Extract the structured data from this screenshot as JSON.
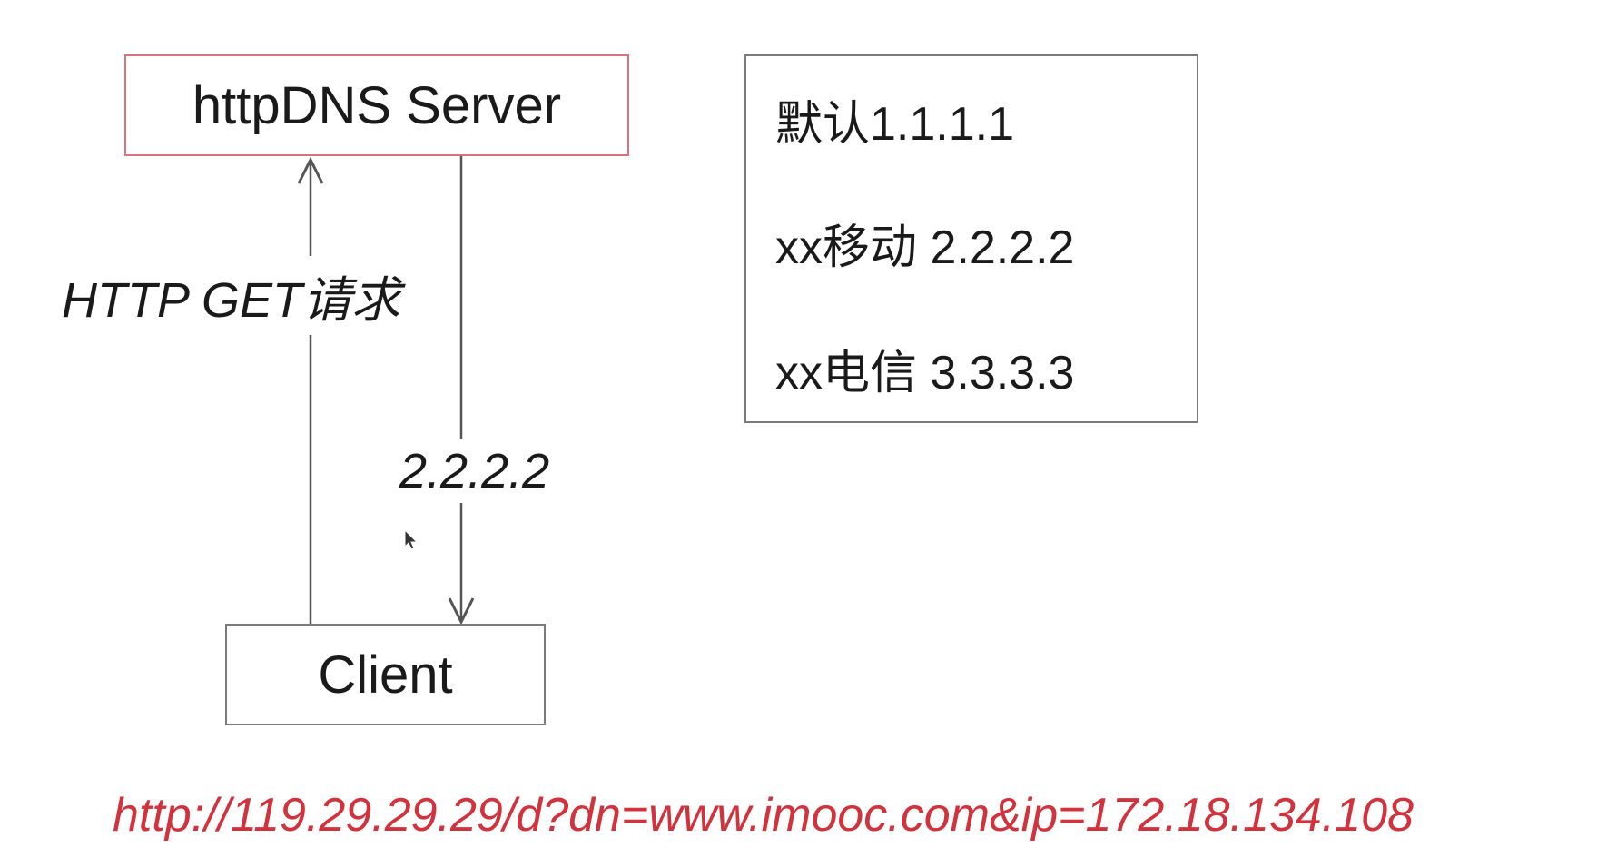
{
  "nodes": {
    "server": "httpDNS Server",
    "client": "Client"
  },
  "edges": {
    "request_label": "HTTP GET请求",
    "response_label": "2.2.2.2"
  },
  "dns_table": {
    "lines": [
      "默认1.1.1.1",
      "xx移动 2.2.2.2",
      "xx电信 3.3.3.3"
    ]
  },
  "url": "http://119.29.29.29/d?dn=www.imooc.com&ip=172.18.134.108",
  "colors": {
    "server_border": "#d9727a",
    "url_text": "#d2323c",
    "arrow": "#555555"
  },
  "icons": {
    "cursor": "mouse-pointer-icon"
  }
}
